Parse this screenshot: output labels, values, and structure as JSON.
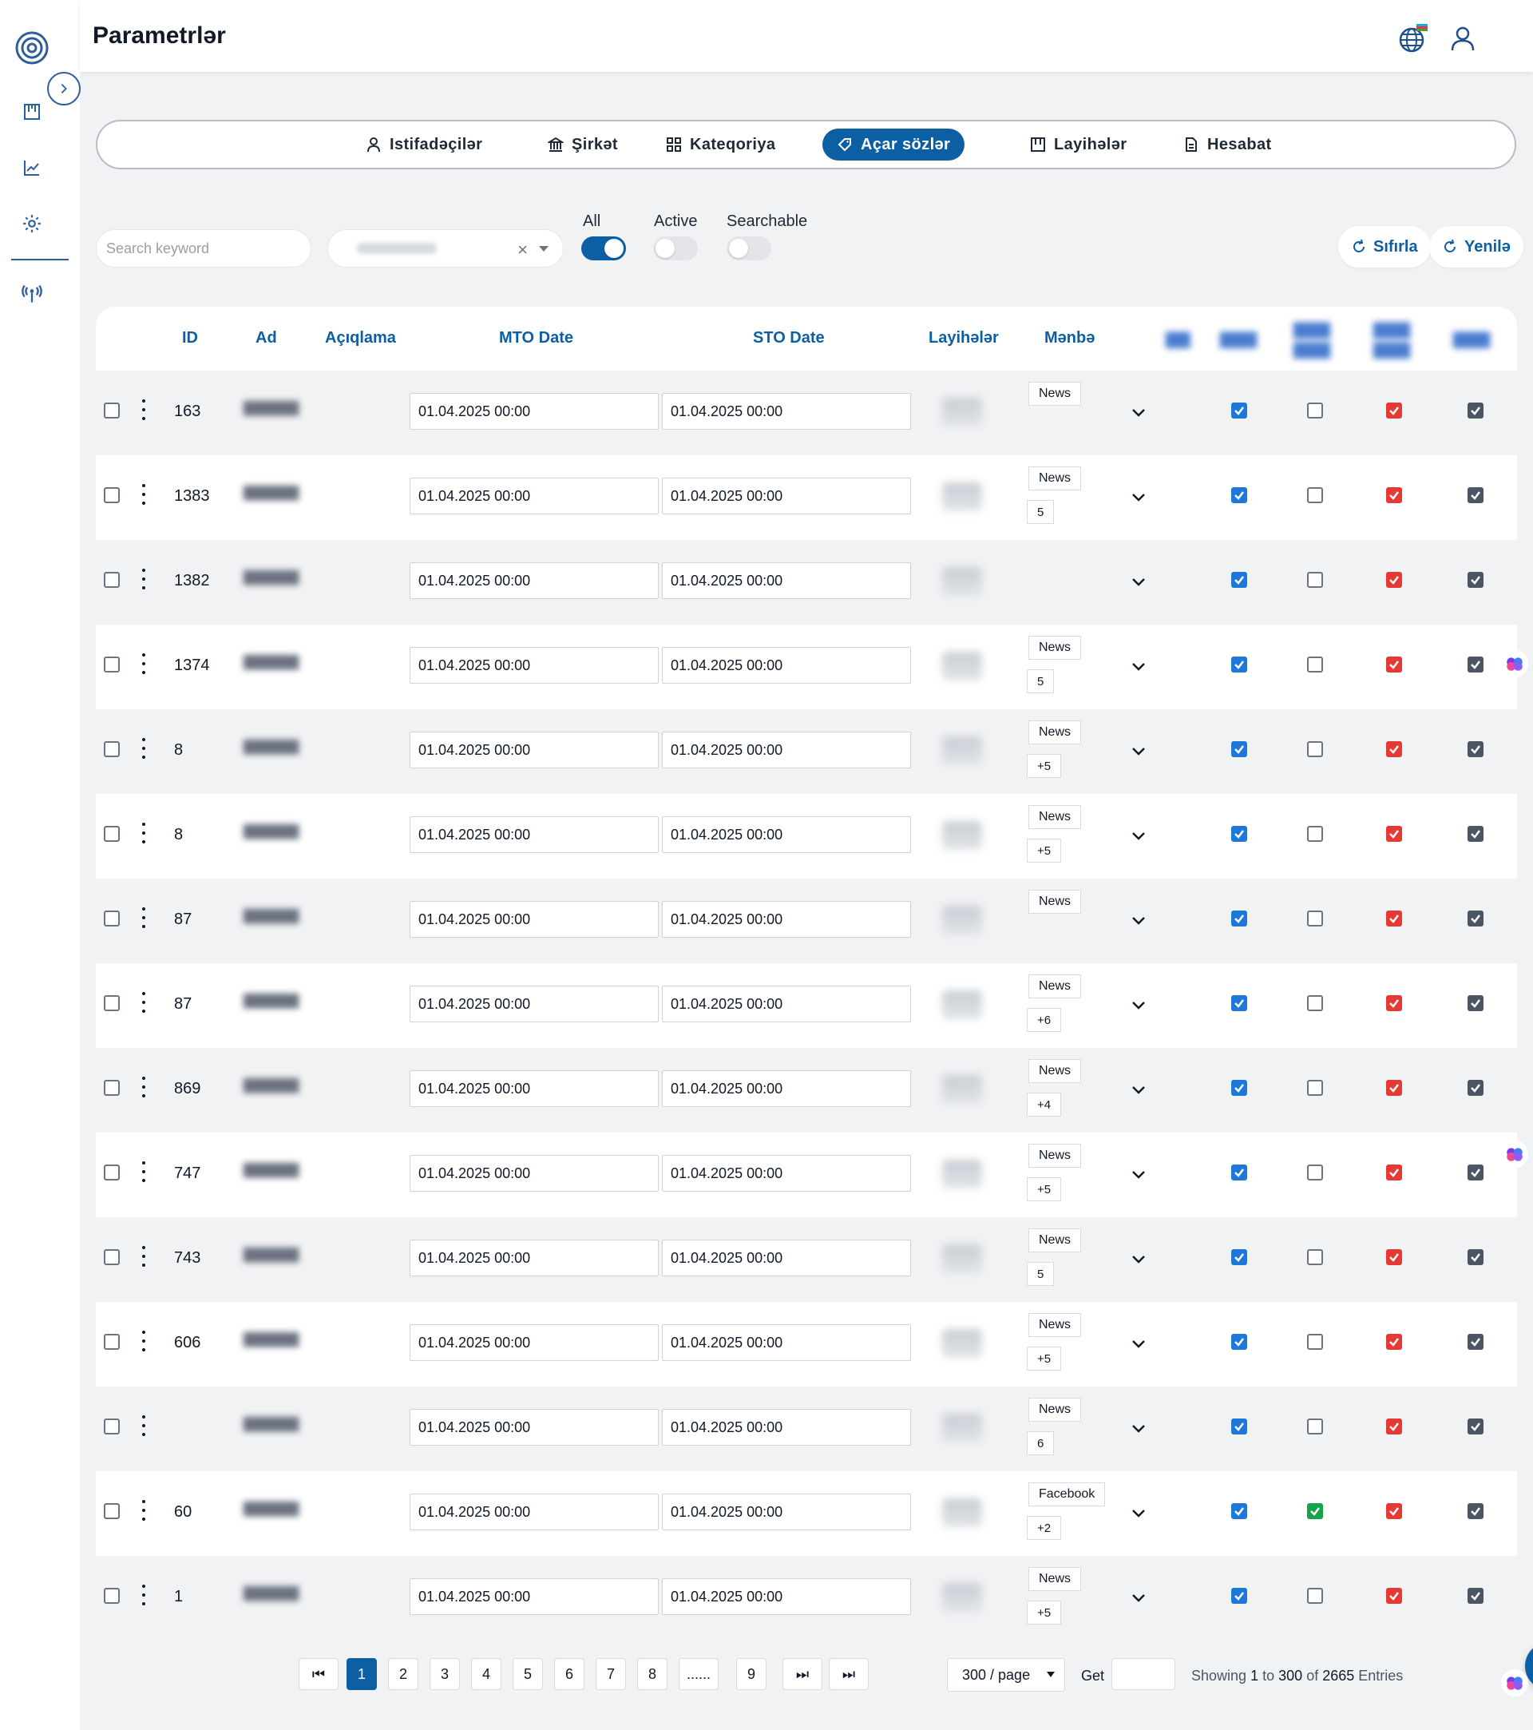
{
  "page": {
    "title": "Parametrlər"
  },
  "tabs": [
    {
      "label": "Istifadəçilər",
      "icon": "user-icon"
    },
    {
      "label": "Şirkət",
      "icon": "bank-icon"
    },
    {
      "label": "Kateqoriya",
      "icon": "grid-icon"
    },
    {
      "label": "Açar sözlər",
      "icon": "tag-icon",
      "active": true
    },
    {
      "label": "Layihələr",
      "icon": "board-icon"
    },
    {
      "label": "Hesabat",
      "icon": "document-icon"
    }
  ],
  "filters": {
    "search_placeholder": "Search keyword",
    "switch_all": "All",
    "switch_active": "Active",
    "switch_searchable": "Searchable",
    "reset_label": "Sıfırla",
    "refresh_label": "Yenilə"
  },
  "table": {
    "columns": [
      "ID",
      "Ad",
      "Açıqlama",
      "MTO Date",
      "STO Date",
      "Layihələr",
      "Mənbə"
    ],
    "rows": [
      {
        "id": "163",
        "mto": "01.04.2025 00:00",
        "sto": "01.04.2025 00:00",
        "source": "News",
        "more": "",
        "c1": "blue",
        "c2": "empty",
        "c3": "red",
        "c4": "gray"
      },
      {
        "id": "1383",
        "mto": "01.04.2025 00:00",
        "sto": "01.04.2025 00:00",
        "source": "News",
        "more": "5",
        "c1": "blue",
        "c2": "empty",
        "c3": "red",
        "c4": "gray"
      },
      {
        "id": "1382",
        "mto": "01.04.2025 00:00",
        "sto": "01.04.2025 00:00",
        "source": "",
        "more": "",
        "c1": "blue",
        "c2": "empty",
        "c3": "red",
        "c4": "gray"
      },
      {
        "id": "1374",
        "mto": "01.04.2025 00:00",
        "sto": "01.04.2025 00:00",
        "source": "News",
        "more": "5",
        "c1": "blue",
        "c2": "empty",
        "c3": "red",
        "c4": "gray"
      },
      {
        "id": "8",
        "mto": "01.04.2025 00:00",
        "sto": "01.04.2025 00:00",
        "source": "News",
        "more": "+5",
        "c1": "blue",
        "c2": "empty",
        "c3": "red",
        "c4": "gray"
      },
      {
        "id": "8",
        "mto": "01.04.2025 00:00",
        "sto": "01.04.2025 00:00",
        "source": "News",
        "more": "+5",
        "c1": "blue",
        "c2": "empty",
        "c3": "red",
        "c4": "gray"
      },
      {
        "id": "87",
        "mto": "01.04.2025 00:00",
        "sto": "01.04.2025 00:00",
        "source": "News",
        "more": "",
        "c1": "blue",
        "c2": "empty",
        "c3": "red",
        "c4": "gray"
      },
      {
        "id": "87",
        "mto": "01.04.2025 00:00",
        "sto": "01.04.2025 00:00",
        "source": "News",
        "more": "+6",
        "c1": "blue",
        "c2": "empty",
        "c3": "red",
        "c4": "gray"
      },
      {
        "id": "869",
        "mto": "01.04.2025 00:00",
        "sto": "01.04.2025 00:00",
        "source": "News",
        "more": "+4",
        "c1": "blue",
        "c2": "empty",
        "c3": "red",
        "c4": "gray"
      },
      {
        "id": "747",
        "mto": "01.04.2025 00:00",
        "sto": "01.04.2025 00:00",
        "source": "News",
        "more": "+5",
        "c1": "blue",
        "c2": "empty",
        "c3": "red",
        "c4": "gray"
      },
      {
        "id": "743",
        "mto": "01.04.2025 00:00",
        "sto": "01.04.2025 00:00",
        "source": "News",
        "more": "5",
        "c1": "blue",
        "c2": "empty",
        "c3": "red",
        "c4": "gray"
      },
      {
        "id": "606",
        "mto": "01.04.2025 00:00",
        "sto": "01.04.2025 00:00",
        "source": "News",
        "more": "+5",
        "c1": "blue",
        "c2": "empty",
        "c3": "red",
        "c4": "gray"
      },
      {
        "id": "",
        "mto": "01.04.2025 00:00",
        "sto": "01.04.2025 00:00",
        "source": "News",
        "more": "6",
        "c1": "blue",
        "c2": "empty",
        "c3": "red",
        "c4": "gray"
      },
      {
        "id": "60",
        "mto": "01.04.2025 00:00",
        "sto": "01.04.2025 00:00",
        "source": "Facebook",
        "more": "+2",
        "c1": "blue",
        "c2": "green",
        "c3": "red",
        "c4": "gray"
      },
      {
        "id": "1",
        "mto": "01.04.2025 00:00",
        "sto": "01.04.2025 00:00",
        "source": "News",
        "more": "+5",
        "c1": "blue",
        "c2": "empty",
        "c3": "red",
        "c4": "gray"
      }
    ]
  },
  "pagination": {
    "pages": [
      "1",
      "2",
      "3",
      "4",
      "5",
      "6",
      "7",
      "8",
      "......",
      "9"
    ],
    "current": "1",
    "per_page": "300 / page",
    "get_label": "Get",
    "showing_prefix": "Showing",
    "showing_from": "1",
    "showing_to_word": "to",
    "showing_to": "300",
    "showing_of_word": "of",
    "showing_total": "2665",
    "showing_suffix": "Entries"
  },
  "colors": {
    "primary": "#0d5fa4",
    "checkbox_blue": "#1e78d8",
    "checkbox_red": "#e53935",
    "checkbox_gray": "#4b5563",
    "checkbox_green": "#16a34a"
  }
}
